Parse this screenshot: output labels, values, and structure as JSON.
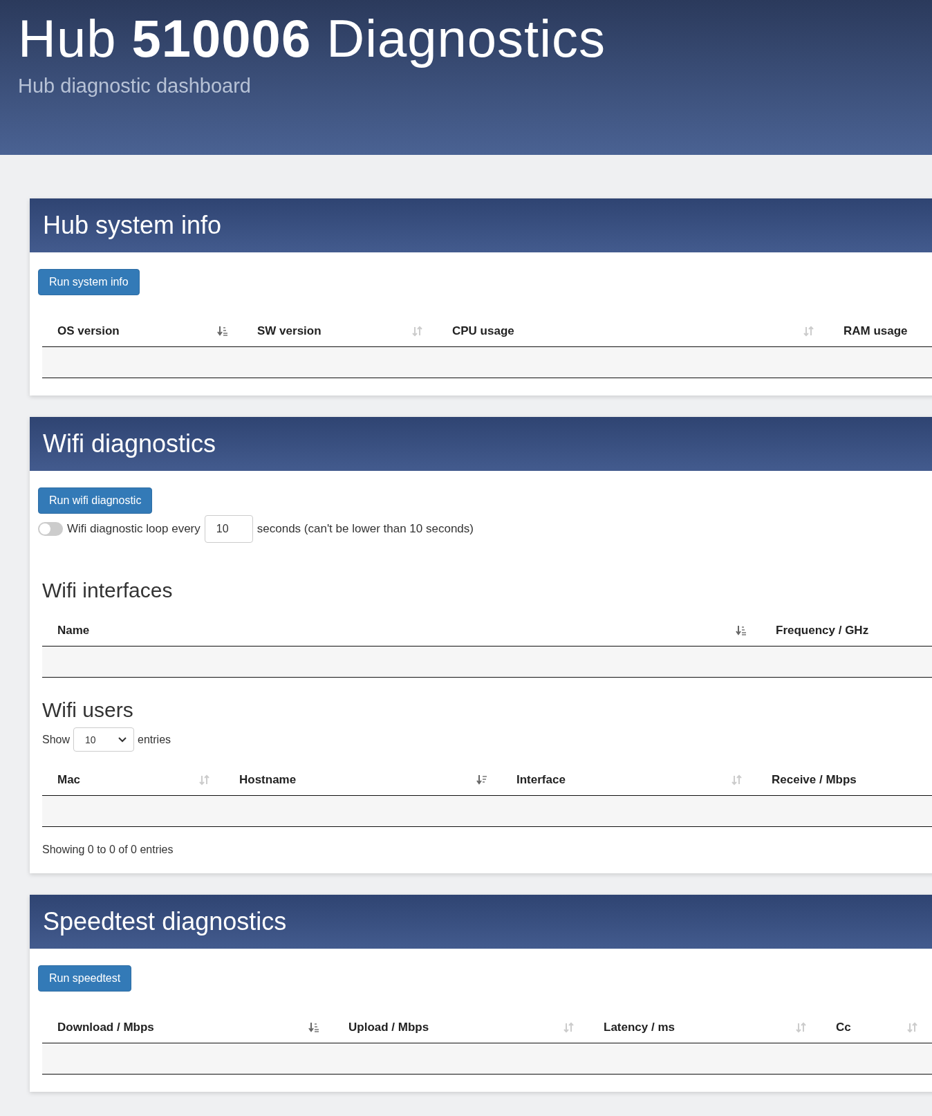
{
  "header": {
    "title": "Hub **510006** Diagnostics",
    "subtitle": "Hub diagnostic dashboard"
  },
  "sections": [
    {
      "title": "Hub system info",
      "button": "Run system info",
      "blocks": [
        {
          "kind": "table",
          "columns": [
            {
              "label": "OS version",
              "kind": "ascending"
            },
            {
              "label": "SW version",
              "kind": "sortable"
            },
            {
              "label": "CPU usage",
              "kind": "sortable"
            },
            {
              "label": "RAM usage",
              "kind": "plain"
            }
          ]
        }
      ]
    },
    {
      "title": "Wifi diagnostics",
      "button": "Run wifi diagnostic",
      "blocks": [
        {
          "kind": "loop",
          "on": false,
          "label": "Wifi diagnostic loop every",
          "value": "10",
          "suffix": "seconds (can't be lower than 10 seconds)"
        },
        {
          "kind": "heading",
          "text": "Wifi interfaces"
        },
        {
          "kind": "table",
          "columns": [
            {
              "label": "Name",
              "kind": "ascending"
            },
            {
              "label": "Frequency / GHz",
              "kind": "plain"
            }
          ]
        },
        {
          "kind": "heading",
          "text": "Wifi users"
        },
        {
          "kind": "length",
          "label": "Show",
          "value": "10",
          "suffix": "entries"
        },
        {
          "kind": "table",
          "columns": [
            {
              "label": "Mac",
              "kind": "sortable"
            },
            {
              "label": "Hostname",
              "kind": "descending"
            },
            {
              "label": "Interface",
              "kind": "sortable"
            },
            {
              "label": "Receive / Mbps",
              "kind": "plain"
            }
          ]
        },
        {
          "kind": "info",
          "text": "Showing 0 to 0 of 0 entries"
        }
      ]
    },
    {
      "title": "Speedtest diagnostics",
      "button": "Run speedtest",
      "blocks": [
        {
          "kind": "table",
          "columns": [
            {
              "label": "Download / Mbps",
              "kind": "ascending"
            },
            {
              "label": "Upload / Mbps",
              "kind": "sortable"
            },
            {
              "label": "Latency / ms",
              "kind": "sortable"
            },
            {
              "label": "Cc",
              "kind": "sortable"
            }
          ]
        }
      ]
    }
  ]
}
